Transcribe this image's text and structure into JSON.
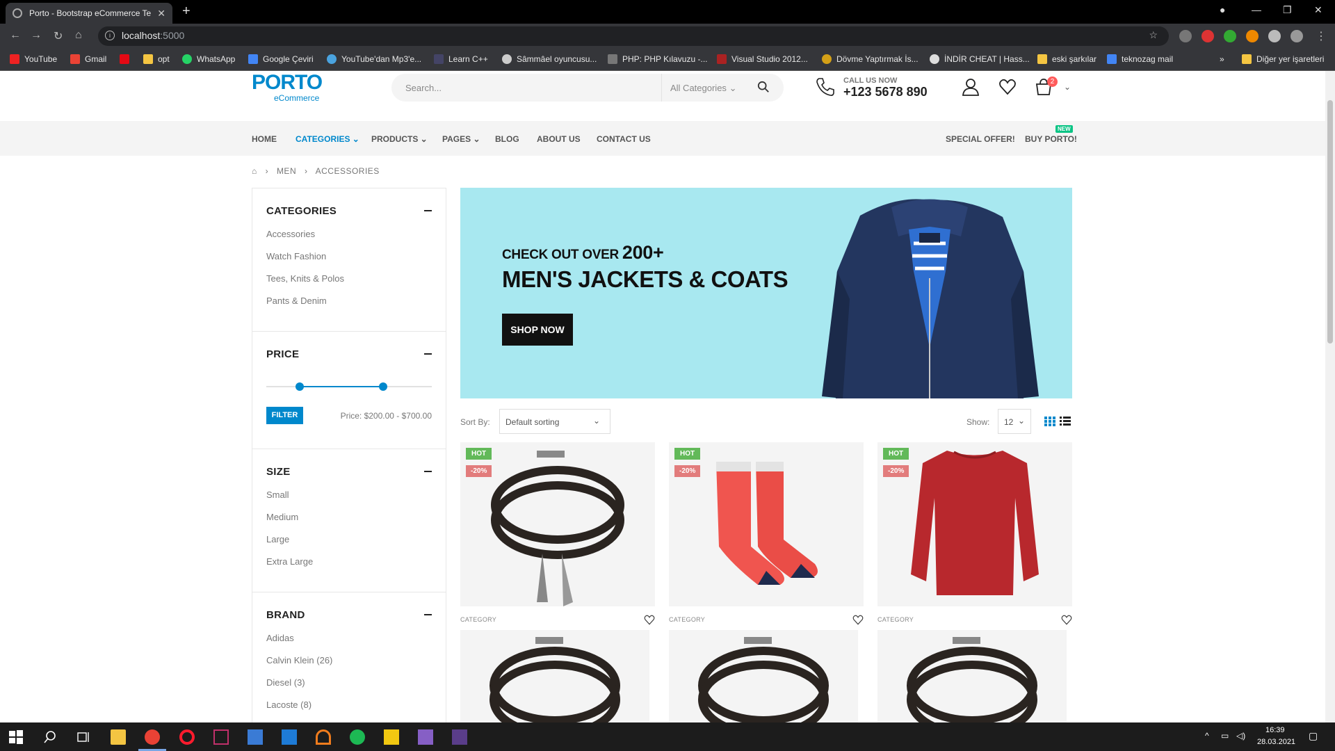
{
  "browser": {
    "tab_title": "Porto - Bootstrap eCommerce Te",
    "url_host": "localhost",
    "url_port": ":5000",
    "bookmarks": [
      "YouTube",
      "Gmail",
      "opt",
      "WhatsApp",
      "Google Çeviri",
      "YouTube'dan Mp3'e...",
      "Learn C++",
      "Sâmmâel oyuncusu...",
      "PHP: PHP Kılavuzu -...",
      "Visual Studio 2012...",
      "Dövme Yaptırmak İs...",
      "İNDİR CHEAT | Hass...",
      "eski şarkılar",
      "teknozag mail"
    ],
    "other_bookmarks": "Diğer yer işaretleri"
  },
  "header": {
    "logo": "PORTO",
    "logo_sub": "eCommerce",
    "search_placeholder": "Search...",
    "search_category": "All Categories",
    "call_label": "CALL US NOW",
    "call_number": "+123 5678 890",
    "cart_count": "2"
  },
  "menu": {
    "items": [
      "HOME",
      "CATEGORIES",
      "PRODUCTS",
      "PAGES",
      "BLOG",
      "ABOUT US",
      "CONTACT US"
    ],
    "right": [
      "SPECIAL OFFER!",
      "BUY PORTO!"
    ],
    "new_badge": "NEW"
  },
  "breadcrumb": [
    "MEN",
    "ACCESSORIES"
  ],
  "sidebar": {
    "categories_title": "CATEGORIES",
    "categories": [
      "Accessories",
      "Watch Fashion",
      "Tees, Knits & Polos",
      "Pants & Denim"
    ],
    "price_title": "PRICE",
    "filter_label": "FILTER",
    "price_text": "Price: $200.00 - $700.00",
    "size_title": "SIZE",
    "sizes": [
      "Small",
      "Medium",
      "Large",
      "Extra Large"
    ],
    "brand_title": "BRAND",
    "brands": [
      "Adidas",
      "Calvin Klein (26)",
      "Diesel (3)",
      "Lacoste (8)"
    ]
  },
  "banner": {
    "line1_a": "CHECK OUT OVER ",
    "line1_b": "200+",
    "line2": "MEN'S JACKETS & COATS",
    "button": "SHOP NOW"
  },
  "toolbar": {
    "sort_label": "Sort By:",
    "sort_value": "Default sorting",
    "show_label": "Show:",
    "show_value": "12"
  },
  "products": [
    {
      "hot": "HOT",
      "discount": "-20%",
      "category": "CATEGORY"
    },
    {
      "hot": "HOT",
      "discount": "-20%",
      "category": "CATEGORY"
    },
    {
      "hot": "HOT",
      "discount": "-20%",
      "category": "CATEGORY"
    }
  ],
  "taskbar": {
    "time": "16:39",
    "date": "28.03.2021"
  },
  "colors": {
    "accent": "#0088cc",
    "hot": "#62b959",
    "discount": "#e27c7c",
    "banner_bg": "#a8e8f0"
  }
}
